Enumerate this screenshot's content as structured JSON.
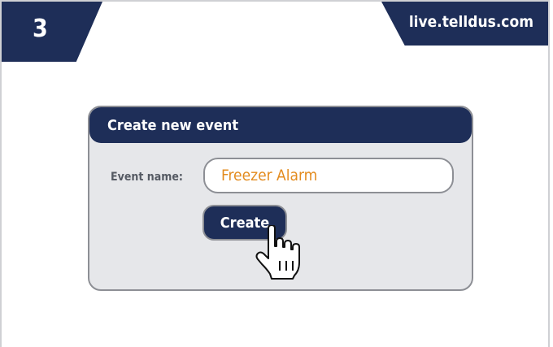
{
  "step": {
    "number": "3"
  },
  "site": {
    "url": "live.telldus.com"
  },
  "dialog": {
    "title": "Create new event",
    "event_name_label": "Event name:",
    "event_name_value": "Freezer Alarm",
    "create_label": "Create"
  },
  "colors": {
    "navy": "#1e2e58",
    "panel": "#e6e7ea",
    "border": "#8d8f95",
    "input_text": "#e38b1e"
  },
  "icons": {
    "cursor": "hand-pointer-icon"
  }
}
